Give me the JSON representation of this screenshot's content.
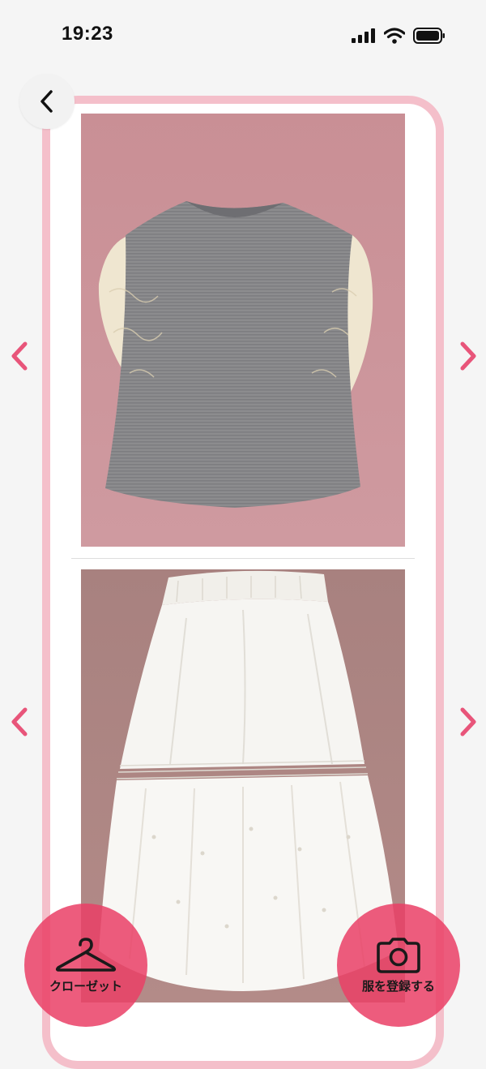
{
  "status_bar": {
    "time": "19:23",
    "icons": [
      "cellular-signal-icon",
      "wifi-icon",
      "battery-icon"
    ]
  },
  "navigation": {
    "back_icon": "chevron-left-icon"
  },
  "carousel": {
    "top": {
      "item": "gray-sweater-with-lace-sleeves",
      "prev_icon": "chevron-left-icon",
      "next_icon": "chevron-right-icon"
    },
    "bottom": {
      "item": "white-tiered-skirt",
      "prev_icon": "chevron-left-icon",
      "next_icon": "chevron-right-icon"
    }
  },
  "actions": {
    "closet_label": "クローゼット",
    "closet_icon": "hanger-icon",
    "register_label": "服を登録する",
    "register_icon": "camera-icon"
  },
  "colors": {
    "accent": "#ea4066",
    "frame": "#f4bfca",
    "arrow": "#e8557a"
  }
}
